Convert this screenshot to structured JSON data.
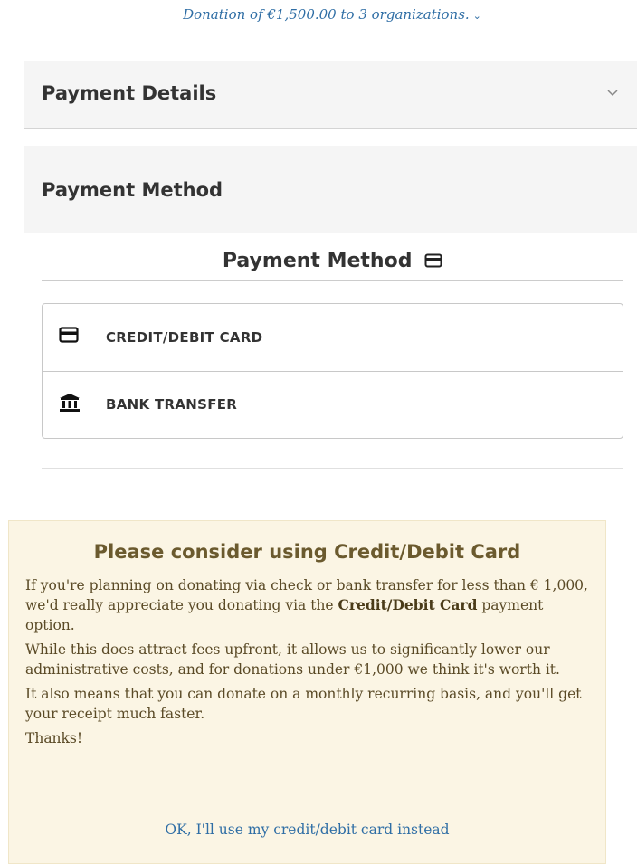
{
  "summary": {
    "text": "Donation of €1,500.00 to 3 organizations."
  },
  "panels": {
    "payment_details": "Payment Details",
    "payment_method": "Payment Method"
  },
  "section": {
    "title": "Payment Method"
  },
  "methods": [
    {
      "label": "CREDIT/DEBIT CARD",
      "icon": "credit-card-icon"
    },
    {
      "label": "BANK TRANSFER",
      "icon": "bank-icon"
    }
  ],
  "notice": {
    "title": "Please consider using Credit/Debit Card",
    "p1_before": "If you're planning on donating via check or bank transfer for less than € 1,000, we'd really appreciate you donating via the ",
    "p1_bold": "Credit/Debit Card",
    "p1_after": " payment option.",
    "p2": "While this does attract fees upfront, it allows us to significantly lower our administrative costs, and for donations under €1,000 we think it's worth it.",
    "p3": "It also means that you can donate on a monthly recurring basis, and you'll get your receipt much faster.",
    "p4": "Thanks!",
    "cta": "OK, I'll use my credit/debit card instead"
  },
  "colors": {
    "link": "#2f6ea5",
    "notice_bg": "#fbf5e4",
    "panel_bg": "#f5f5f5"
  }
}
